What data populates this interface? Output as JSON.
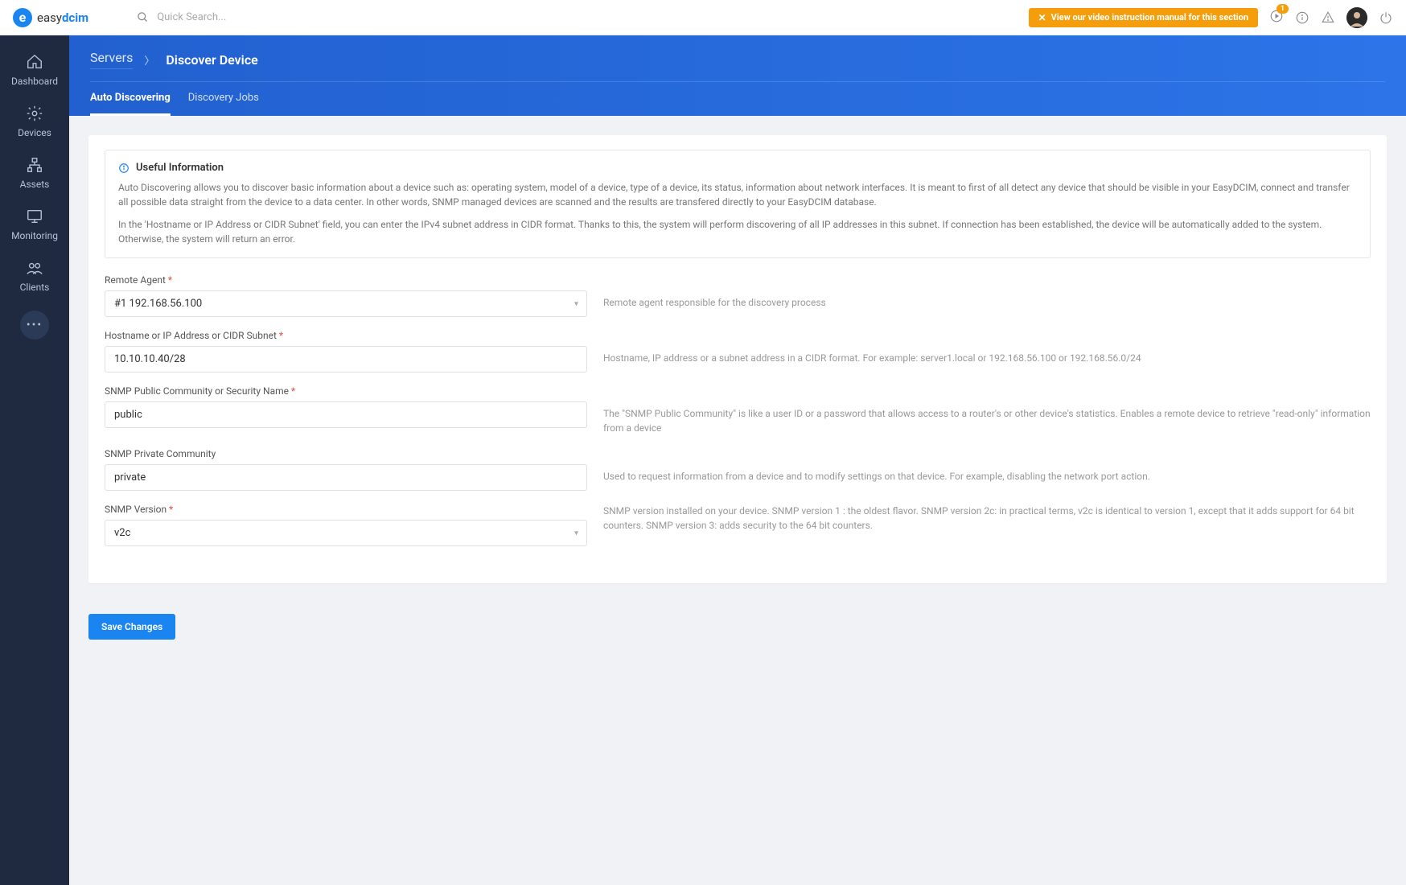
{
  "header": {
    "logo_easy": "easy",
    "logo_dcim": "dcim",
    "search_placeholder": "Quick Search...",
    "banner_text": "View our video instruction manual for this section",
    "notif_count": "1"
  },
  "sidebar": {
    "items": [
      {
        "label": "Dashboard",
        "icon": "home"
      },
      {
        "label": "Devices",
        "icon": "gear"
      },
      {
        "label": "Assets",
        "icon": "hierarchy"
      },
      {
        "label": "Monitoring",
        "icon": "monitor"
      },
      {
        "label": "Clients",
        "icon": "users"
      }
    ]
  },
  "breadcrumb": {
    "link": "Servers",
    "current": "Discover Device"
  },
  "tabs": [
    {
      "label": "Auto Discovering",
      "active": true
    },
    {
      "label": "Discovery Jobs",
      "active": false
    }
  ],
  "info": {
    "title": "Useful Information",
    "p1": "Auto Discovering allows you to discover basic information about a device such as: operating system, model of a device, type of a device, its status, information about network interfaces. It is meant to first of all detect any device that should be visible in your EasyDCIM, connect and transfer all possible data straight from the device to a data center. In other words, SNMP managed devices are scanned and the results are transfered directly to your EasyDCIM database.",
    "p2": "In the 'Hostname or IP Address or CIDR Subnet' field, you can enter the IPv4 subnet address in CIDR format. Thanks to this, the system will perform discovering of all IP addresses in this subnet. If connection has been established, the device will be automatically added to the system. Otherwise, the system will return an error."
  },
  "form": {
    "remote_agent": {
      "label": "Remote Agent",
      "value": "#1 192.168.56.100",
      "help": "Remote agent responsible for the discovery process"
    },
    "hostname": {
      "label": "Hostname or IP Address or CIDR Subnet",
      "value": "10.10.10.40/28",
      "help": "Hostname, IP address or a subnet address in a CIDR format. For example: server1.local or 192.168.56.100 or 192.168.56.0/24"
    },
    "snmp_public": {
      "label": "SNMP Public Community or Security Name",
      "value": "public",
      "help": "The \"SNMP Public Community\" is like a user ID or a password that allows access to a router's or other device's statistics. Enables a remote device to retrieve \"read-only\" information from a device"
    },
    "snmp_private": {
      "label": "SNMP Private Community",
      "value": "private",
      "help": "Used to request information from a device and to modify settings on that device. For example, disabling the network port action."
    },
    "snmp_version": {
      "label": "SNMP Version",
      "value": "v2c",
      "help": "SNMP version installed on your device. SNMP version 1 : the oldest flavor. SNMP version 2c: in practical terms, v2c is identical to version 1, except that it adds support for 64 bit counters. SNMP version 3: adds security to the 64 bit counters."
    }
  },
  "footer": {
    "save_label": "Save Changes"
  }
}
